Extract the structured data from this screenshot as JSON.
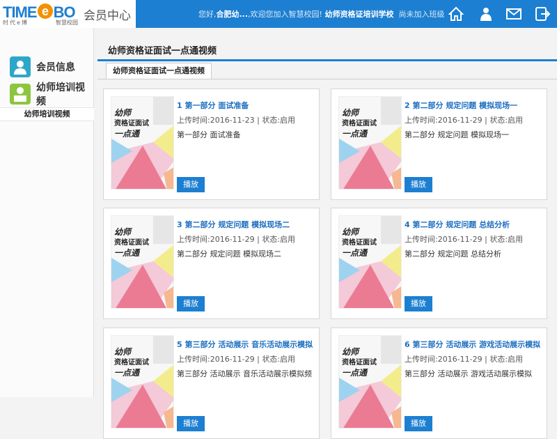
{
  "header": {
    "logo": "TIME",
    "logo_e": "e",
    "logo_bo": "BO",
    "logo_sub": "时代e博",
    "logo_sub2": "智慧校园",
    "member_center": "会员中心",
    "greeting_pre": "您好,",
    "user": "合肥幼...",
    "greeting_mid": ",欢迎您加入智慧校园!",
    "school": "幼师资格证培训学校",
    "class_status": "尚未加入班级"
  },
  "sidebar": {
    "items": [
      {
        "label": "会员信息",
        "icon": "user-icon"
      },
      {
        "label": "幼师培训视频",
        "icon": "video-training-icon"
      }
    ],
    "sub_item": "幼师培训视频"
  },
  "main": {
    "title": "幼师资格证面试一点通视频",
    "tab": "幼师资格证面试一点通视频"
  },
  "thumb": {
    "t1": "幼师",
    "t2": "资格证面试",
    "t3": "一点通"
  },
  "cards": [
    {
      "title": "1 第一部分 面试准备",
      "meta": "上传时间:2016-11-23 | 状态:启用",
      "desc": "第一部分 面试准备",
      "play": "播放"
    },
    {
      "title": "2 第二部分 规定问题 模拟现场一",
      "meta": "上传时间:2016-11-29 | 状态:启用",
      "desc": "第二部分 规定问题 模拟现场一",
      "play": "播放"
    },
    {
      "title": "3 第二部分 规定问题 模拟现场二",
      "meta": "上传时间:2016-11-29 | 状态:启用",
      "desc": "第二部分 规定问题 模拟现场二",
      "play": "播放"
    },
    {
      "title": "4 第二部分 规定问题 总结分析",
      "meta": "上传时间:2016-11-29 | 状态:启用",
      "desc": "第二部分 规定问题 总结分析",
      "play": "播放"
    },
    {
      "title": "5 第三部分 活动展示 音乐活动展示模拟",
      "meta": "上传时间:2016-11-29 | 状态:启用",
      "desc": "第三部分 活动展示 音乐活动展示模拟频",
      "play": "播放"
    },
    {
      "title": "6 第三部分 活动展示 游戏活动展示模拟",
      "meta": "上传时间:2016-11-29 | 状态:启用",
      "desc": "第三部分 活动展示 游戏活动展示模拟",
      "play": "播放"
    }
  ],
  "colors": {
    "accent": "#1d7fd1",
    "orange": "#f29100"
  }
}
